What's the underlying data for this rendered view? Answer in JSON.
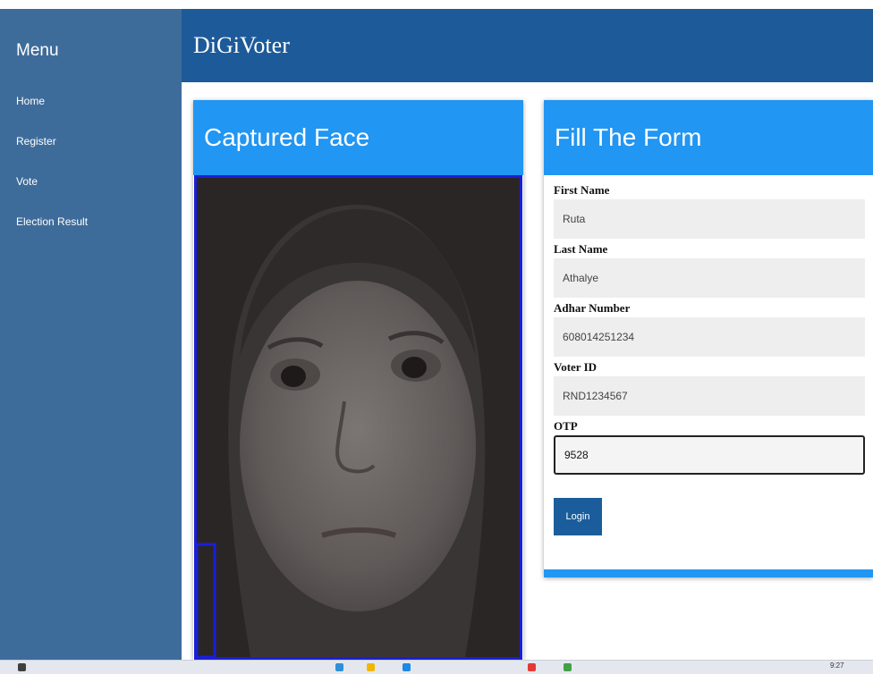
{
  "sidebar": {
    "title": "Menu",
    "items": [
      {
        "label": "Home"
      },
      {
        "label": "Register"
      },
      {
        "label": "Vote"
      },
      {
        "label": "Election Result"
      }
    ]
  },
  "header": {
    "app_title": "DiGiVoter"
  },
  "face_card": {
    "title": "Captured Face"
  },
  "form_card": {
    "title": "Fill The Form",
    "fields": [
      {
        "label": "First Name",
        "value": "Ruta"
      },
      {
        "label": "Last Name",
        "value": "Athalye"
      },
      {
        "label": "Adhar Number",
        "value": "608014251234"
      },
      {
        "label": "Voter ID",
        "value": "RND1234567"
      },
      {
        "label": "OTP",
        "value": "9528"
      }
    ],
    "submit_label": "Login"
  },
  "colors": {
    "sidebar": "#3e6c9a",
    "header": "#1d5a99",
    "card_header": "#2196f3",
    "button": "#1b5d9c",
    "face_frame": "#1b1fd6"
  },
  "taskbar": {
    "time": "9:27"
  }
}
